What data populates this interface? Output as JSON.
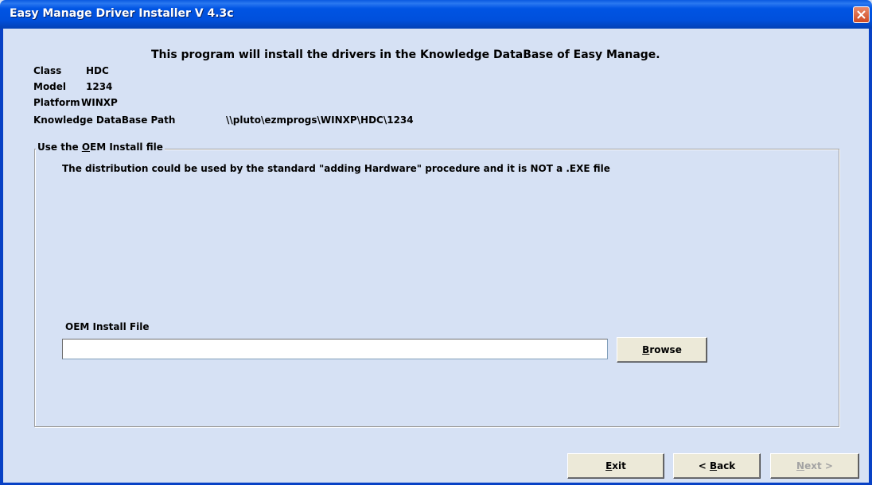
{
  "window": {
    "title": "Easy Manage Driver Installer V 4.3c",
    "close_icon": "close-icon"
  },
  "heading": "This program will install the drivers in the Knowledge DataBase of Easy Manage.",
  "info": {
    "class_label": "Class",
    "class_value": "HDC",
    "model_label": "Model",
    "model_value": "1234",
    "platform_label": "Platform",
    "platform_value": "WINXP",
    "path_label": "Knowledge DataBase Path",
    "path_value": "\\\\pluto\\ezmprogs\\WINXP\\HDC\\1234"
  },
  "group": {
    "legend_pre": "Use the ",
    "legend_mnemonic": "O",
    "legend_post": "EM Install file",
    "description": "The distribution could be used by the standard \"adding Hardware\" procedure and it is NOT a .EXE file",
    "oem_label": "OEM Install File",
    "oem_value": ""
  },
  "buttons": {
    "browse_mnemonic": "B",
    "browse_rest": "rowse",
    "exit_mnemonic": "E",
    "exit_rest": "xit",
    "back_prefix": "< ",
    "back_mnemonic": "B",
    "back_rest": "ack",
    "next_mnemonic": "N",
    "next_rest": "ext >",
    "next_enabled": false
  },
  "colors": {
    "title_bar": "#0054e3",
    "dialog_bg": "#d6e1f4",
    "close_button": "#cf4a23"
  }
}
